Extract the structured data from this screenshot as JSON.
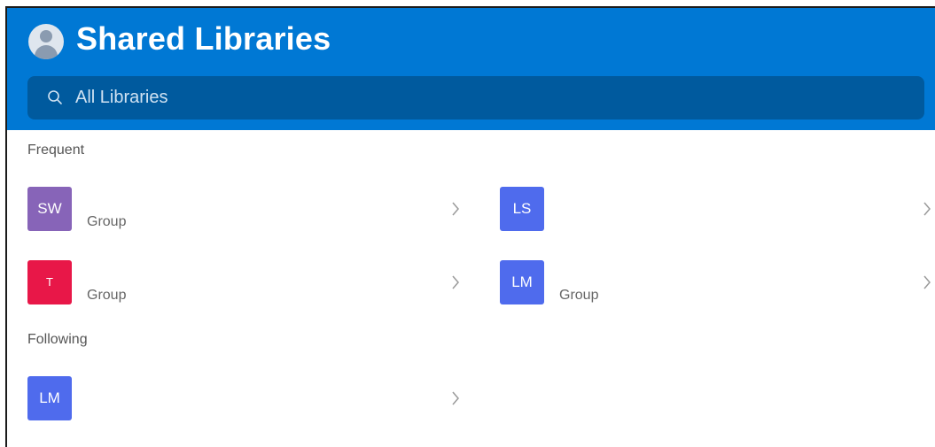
{
  "header": {
    "title": "Shared Libraries",
    "background_color": "#0078d4",
    "avatar_icon": "person-avatar-icon"
  },
  "search": {
    "placeholder": "All Libraries",
    "value": "",
    "icon": "search-icon",
    "background_color": "#005a9e"
  },
  "sections": {
    "frequent": {
      "label": "Frequent",
      "items": [
        {
          "initials": "SW",
          "name": "",
          "subtitle": "Group",
          "color": "#8764b8"
        },
        {
          "initials": "LS",
          "name": "",
          "subtitle": "",
          "color": "#4f6bed"
        },
        {
          "initials": "T",
          "name": "",
          "subtitle": "Group",
          "color": "#e81748"
        },
        {
          "initials": "LM",
          "name": "",
          "subtitle": "Group",
          "color": "#4f6bed"
        }
      ]
    },
    "following": {
      "label": "Following",
      "items": [
        {
          "initials": "LM",
          "name": "",
          "subtitle": "",
          "color": "#4f6bed"
        }
      ]
    }
  }
}
